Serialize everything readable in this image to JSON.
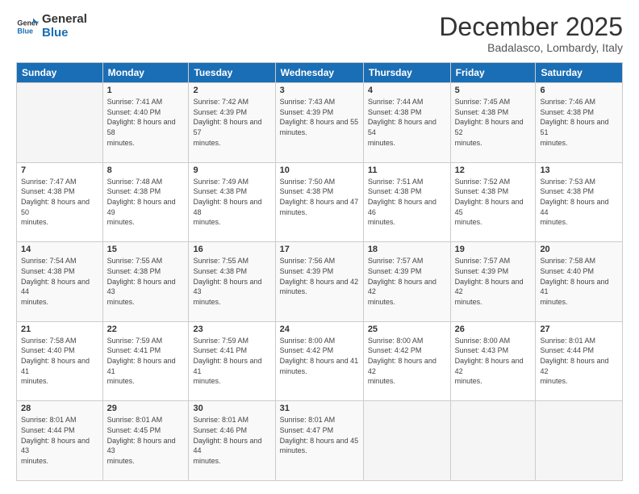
{
  "logo": {
    "line1": "General",
    "line2": "Blue"
  },
  "header": {
    "month": "December 2025",
    "location": "Badalasco, Lombardy, Italy"
  },
  "days_of_week": [
    "Sunday",
    "Monday",
    "Tuesday",
    "Wednesday",
    "Thursday",
    "Friday",
    "Saturday"
  ],
  "weeks": [
    [
      {
        "day": "",
        "sunrise": "",
        "sunset": "",
        "daylight": ""
      },
      {
        "day": "1",
        "sunrise": "7:41 AM",
        "sunset": "4:40 PM",
        "daylight": "8 hours and 58 minutes."
      },
      {
        "day": "2",
        "sunrise": "7:42 AM",
        "sunset": "4:39 PM",
        "daylight": "8 hours and 57 minutes."
      },
      {
        "day": "3",
        "sunrise": "7:43 AM",
        "sunset": "4:39 PM",
        "daylight": "8 hours and 55 minutes."
      },
      {
        "day": "4",
        "sunrise": "7:44 AM",
        "sunset": "4:38 PM",
        "daylight": "8 hours and 54 minutes."
      },
      {
        "day": "5",
        "sunrise": "7:45 AM",
        "sunset": "4:38 PM",
        "daylight": "8 hours and 52 minutes."
      },
      {
        "day": "6",
        "sunrise": "7:46 AM",
        "sunset": "4:38 PM",
        "daylight": "8 hours and 51 minutes."
      }
    ],
    [
      {
        "day": "7",
        "sunrise": "7:47 AM",
        "sunset": "4:38 PM",
        "daylight": "8 hours and 50 minutes."
      },
      {
        "day": "8",
        "sunrise": "7:48 AM",
        "sunset": "4:38 PM",
        "daylight": "8 hours and 49 minutes."
      },
      {
        "day": "9",
        "sunrise": "7:49 AM",
        "sunset": "4:38 PM",
        "daylight": "8 hours and 48 minutes."
      },
      {
        "day": "10",
        "sunrise": "7:50 AM",
        "sunset": "4:38 PM",
        "daylight": "8 hours and 47 minutes."
      },
      {
        "day": "11",
        "sunrise": "7:51 AM",
        "sunset": "4:38 PM",
        "daylight": "8 hours and 46 minutes."
      },
      {
        "day": "12",
        "sunrise": "7:52 AM",
        "sunset": "4:38 PM",
        "daylight": "8 hours and 45 minutes."
      },
      {
        "day": "13",
        "sunrise": "7:53 AM",
        "sunset": "4:38 PM",
        "daylight": "8 hours and 44 minutes."
      }
    ],
    [
      {
        "day": "14",
        "sunrise": "7:54 AM",
        "sunset": "4:38 PM",
        "daylight": "8 hours and 44 minutes."
      },
      {
        "day": "15",
        "sunrise": "7:55 AM",
        "sunset": "4:38 PM",
        "daylight": "8 hours and 43 minutes."
      },
      {
        "day": "16",
        "sunrise": "7:55 AM",
        "sunset": "4:38 PM",
        "daylight": "8 hours and 43 minutes."
      },
      {
        "day": "17",
        "sunrise": "7:56 AM",
        "sunset": "4:39 PM",
        "daylight": "8 hours and 42 minutes."
      },
      {
        "day": "18",
        "sunrise": "7:57 AM",
        "sunset": "4:39 PM",
        "daylight": "8 hours and 42 minutes."
      },
      {
        "day": "19",
        "sunrise": "7:57 AM",
        "sunset": "4:39 PM",
        "daylight": "8 hours and 42 minutes."
      },
      {
        "day": "20",
        "sunrise": "7:58 AM",
        "sunset": "4:40 PM",
        "daylight": "8 hours and 41 minutes."
      }
    ],
    [
      {
        "day": "21",
        "sunrise": "7:58 AM",
        "sunset": "4:40 PM",
        "daylight": "8 hours and 41 minutes."
      },
      {
        "day": "22",
        "sunrise": "7:59 AM",
        "sunset": "4:41 PM",
        "daylight": "8 hours and 41 minutes."
      },
      {
        "day": "23",
        "sunrise": "7:59 AM",
        "sunset": "4:41 PM",
        "daylight": "8 hours and 41 minutes."
      },
      {
        "day": "24",
        "sunrise": "8:00 AM",
        "sunset": "4:42 PM",
        "daylight": "8 hours and 41 minutes."
      },
      {
        "day": "25",
        "sunrise": "8:00 AM",
        "sunset": "4:42 PM",
        "daylight": "8 hours and 42 minutes."
      },
      {
        "day": "26",
        "sunrise": "8:00 AM",
        "sunset": "4:43 PM",
        "daylight": "8 hours and 42 minutes."
      },
      {
        "day": "27",
        "sunrise": "8:01 AM",
        "sunset": "4:44 PM",
        "daylight": "8 hours and 42 minutes."
      }
    ],
    [
      {
        "day": "28",
        "sunrise": "8:01 AM",
        "sunset": "4:44 PM",
        "daylight": "8 hours and 43 minutes."
      },
      {
        "day": "29",
        "sunrise": "8:01 AM",
        "sunset": "4:45 PM",
        "daylight": "8 hours and 43 minutes."
      },
      {
        "day": "30",
        "sunrise": "8:01 AM",
        "sunset": "4:46 PM",
        "daylight": "8 hours and 44 minutes."
      },
      {
        "day": "31",
        "sunrise": "8:01 AM",
        "sunset": "4:47 PM",
        "daylight": "8 hours and 45 minutes."
      },
      {
        "day": "",
        "sunrise": "",
        "sunset": "",
        "daylight": ""
      },
      {
        "day": "",
        "sunrise": "",
        "sunset": "",
        "daylight": ""
      },
      {
        "day": "",
        "sunrise": "",
        "sunset": "",
        "daylight": ""
      }
    ]
  ],
  "labels": {
    "sunrise_prefix": "Sunrise: ",
    "sunset_prefix": "Sunset: ",
    "daylight_prefix": "Daylight: "
  }
}
